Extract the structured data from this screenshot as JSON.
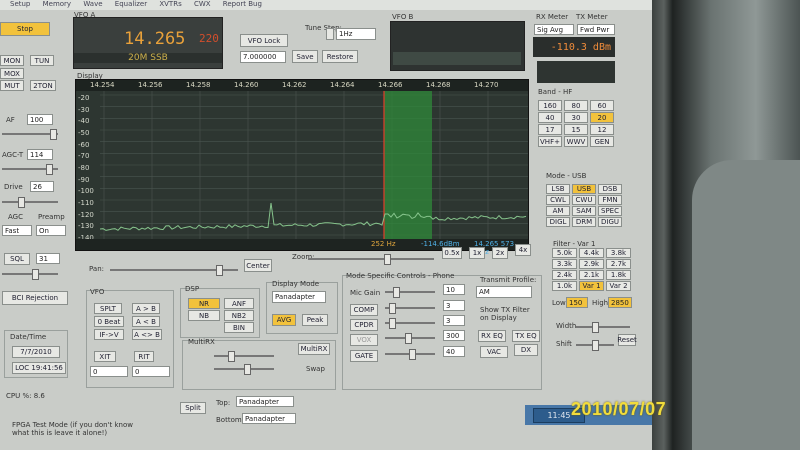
{
  "menu": [
    "Setup",
    "Memory",
    "Wave",
    "Equalizer",
    "XVTRs",
    "CWX",
    "Report Bug"
  ],
  "left": {
    "start_label": "Stop",
    "modes": [
      "MON",
      "TUN",
      "MOX",
      "MUT",
      "2TON"
    ],
    "af_label": "AF",
    "af_value": "100",
    "agct_label": "AGC-T",
    "agct_value": "114",
    "drive_label": "Drive",
    "drive_value": "26",
    "agc_label": "AGC",
    "agc_value": "Fast",
    "preamp_label": "Preamp",
    "preamp_value": "On",
    "sql_label": "SQL",
    "sql_value": "31",
    "bci_label": "BCI Rejection",
    "datetime_label": "Date/Time",
    "date": "7/7/2010",
    "time": "LOC 19:41:56",
    "cpu": "CPU %: 8.6"
  },
  "vfo_a": {
    "title": "VFO A",
    "freq": "14.265",
    "sub": "220",
    "mode": "20M SSB"
  },
  "vfo_controls": {
    "lock": "VFO Lock",
    "tune_label": "Tune Step:",
    "tune_value": "1Hz",
    "freq_box": "7.000000",
    "save": "Save",
    "restore": "Restore"
  },
  "vfo_b": {
    "title": "VFO B"
  },
  "meter": {
    "rx_meter": "RX Meter",
    "tx_meter": "TX Meter",
    "rx_select": "Sig Avg",
    "tx_select": "Fwd Pwr",
    "value": "-110.3 dBm"
  },
  "band": {
    "title": "Band - HF",
    "buttons": [
      "160",
      "80",
      "60",
      "40",
      "30",
      "20",
      "17",
      "15",
      "12",
      "VHF+",
      "WWV",
      "GEN"
    ],
    "active": "20"
  },
  "mode_panel": {
    "title": "Mode - USB",
    "buttons": [
      "LSB",
      "USB",
      "DSB",
      "CWL",
      "CWU",
      "FMN",
      "AM",
      "SAM",
      "SPEC",
      "DIGL",
      "DRM",
      "DIGU"
    ],
    "active": "USB"
  },
  "filter": {
    "title": "Filter - Var 1",
    "buttons": [
      "5.0k",
      "4.4k",
      "3.8k",
      "3.3k",
      "2.9k",
      "2.7k",
      "2.4k",
      "2.1k",
      "1.8k",
      "1.0k",
      "Var 1",
      "Var 2"
    ],
    "active": "Var 1",
    "low_label": "Low",
    "low_value": "150",
    "high_label": "High",
    "high_value": "2850",
    "width_label": "Width",
    "shift_label": "Shift",
    "reset_label": "Reset"
  },
  "display": {
    "title": "Display",
    "freq_labels": [
      "14.254",
      "14.256",
      "14.258",
      "14.260",
      "14.262",
      "14.264",
      "14.266",
      "14.268",
      "14.270"
    ],
    "db_labels": [
      "-20",
      "-30",
      "-40",
      "-50",
      "-60",
      "-70",
      "-80",
      "-90",
      "-100",
      "-110",
      "-120",
      "-130",
      "-140"
    ],
    "status_left": "252 Hz",
    "status_mid": "-114.6dBm",
    "status_right": "14.265 573 MHz",
    "cursor_color": "#e23c28",
    "passband_color": "#2f8a3a",
    "trace_color": "#86c48c"
  },
  "pan_zoom": {
    "pan_label": "Pan:",
    "center_label": "Center",
    "zoom_label": "Zoom:",
    "zooms": [
      "0.5x",
      "1x",
      "2x",
      "4x"
    ]
  },
  "vfo_panel": {
    "title": "VFO",
    "buttons": [
      "SPLT",
      "A > B",
      "0 Beat",
      "A < B",
      "IF->V",
      "A <> B"
    ],
    "xit_label": "XIT",
    "xit_value": "0",
    "rit_label": "RIT",
    "rit_value": "0"
  },
  "dsp": {
    "title": "DSP",
    "buttons": [
      "NR",
      "ANF",
      "NB",
      "NB2",
      "",
      "BIN"
    ],
    "active": [
      "NR"
    ]
  },
  "display_mode": {
    "title": "Display Mode",
    "value": "Panadapter",
    "avg": "AVG",
    "peak": "Peak"
  },
  "multirx": {
    "title": "MultiRX",
    "button": "MultiRX",
    "swap": "Swap"
  },
  "phone": {
    "title": "Mode Specific Controls - Phone",
    "mic_label": "Mic Gain",
    "mic_value": "10",
    "comp_label": "COMP",
    "comp_value": "3",
    "cpdr_label": "CPDR",
    "cpdr_value": "3",
    "vox_label": "VOX",
    "vox_value": "300",
    "gate_label": "GATE",
    "gate_value": "40",
    "tx_profile_label": "Transmit Profile:",
    "tx_profile_value": "AM",
    "show_tx": "Show TX Filter on Display",
    "rx_eq": "RX EQ",
    "tx_eq": "TX EQ",
    "vac": "VAC",
    "dx": "DX"
  },
  "bottom_bar": {
    "split": "Split",
    "top_label": "Top:",
    "top_value": "Panadapter",
    "bottom_label": "Bottom:",
    "bottom_value": "Panadapter",
    "fpga": "FPGA Test Mode (if you don't know what this is leave it alone!)",
    "clock": "11:45"
  },
  "photo_stamp": "2010/07/07"
}
